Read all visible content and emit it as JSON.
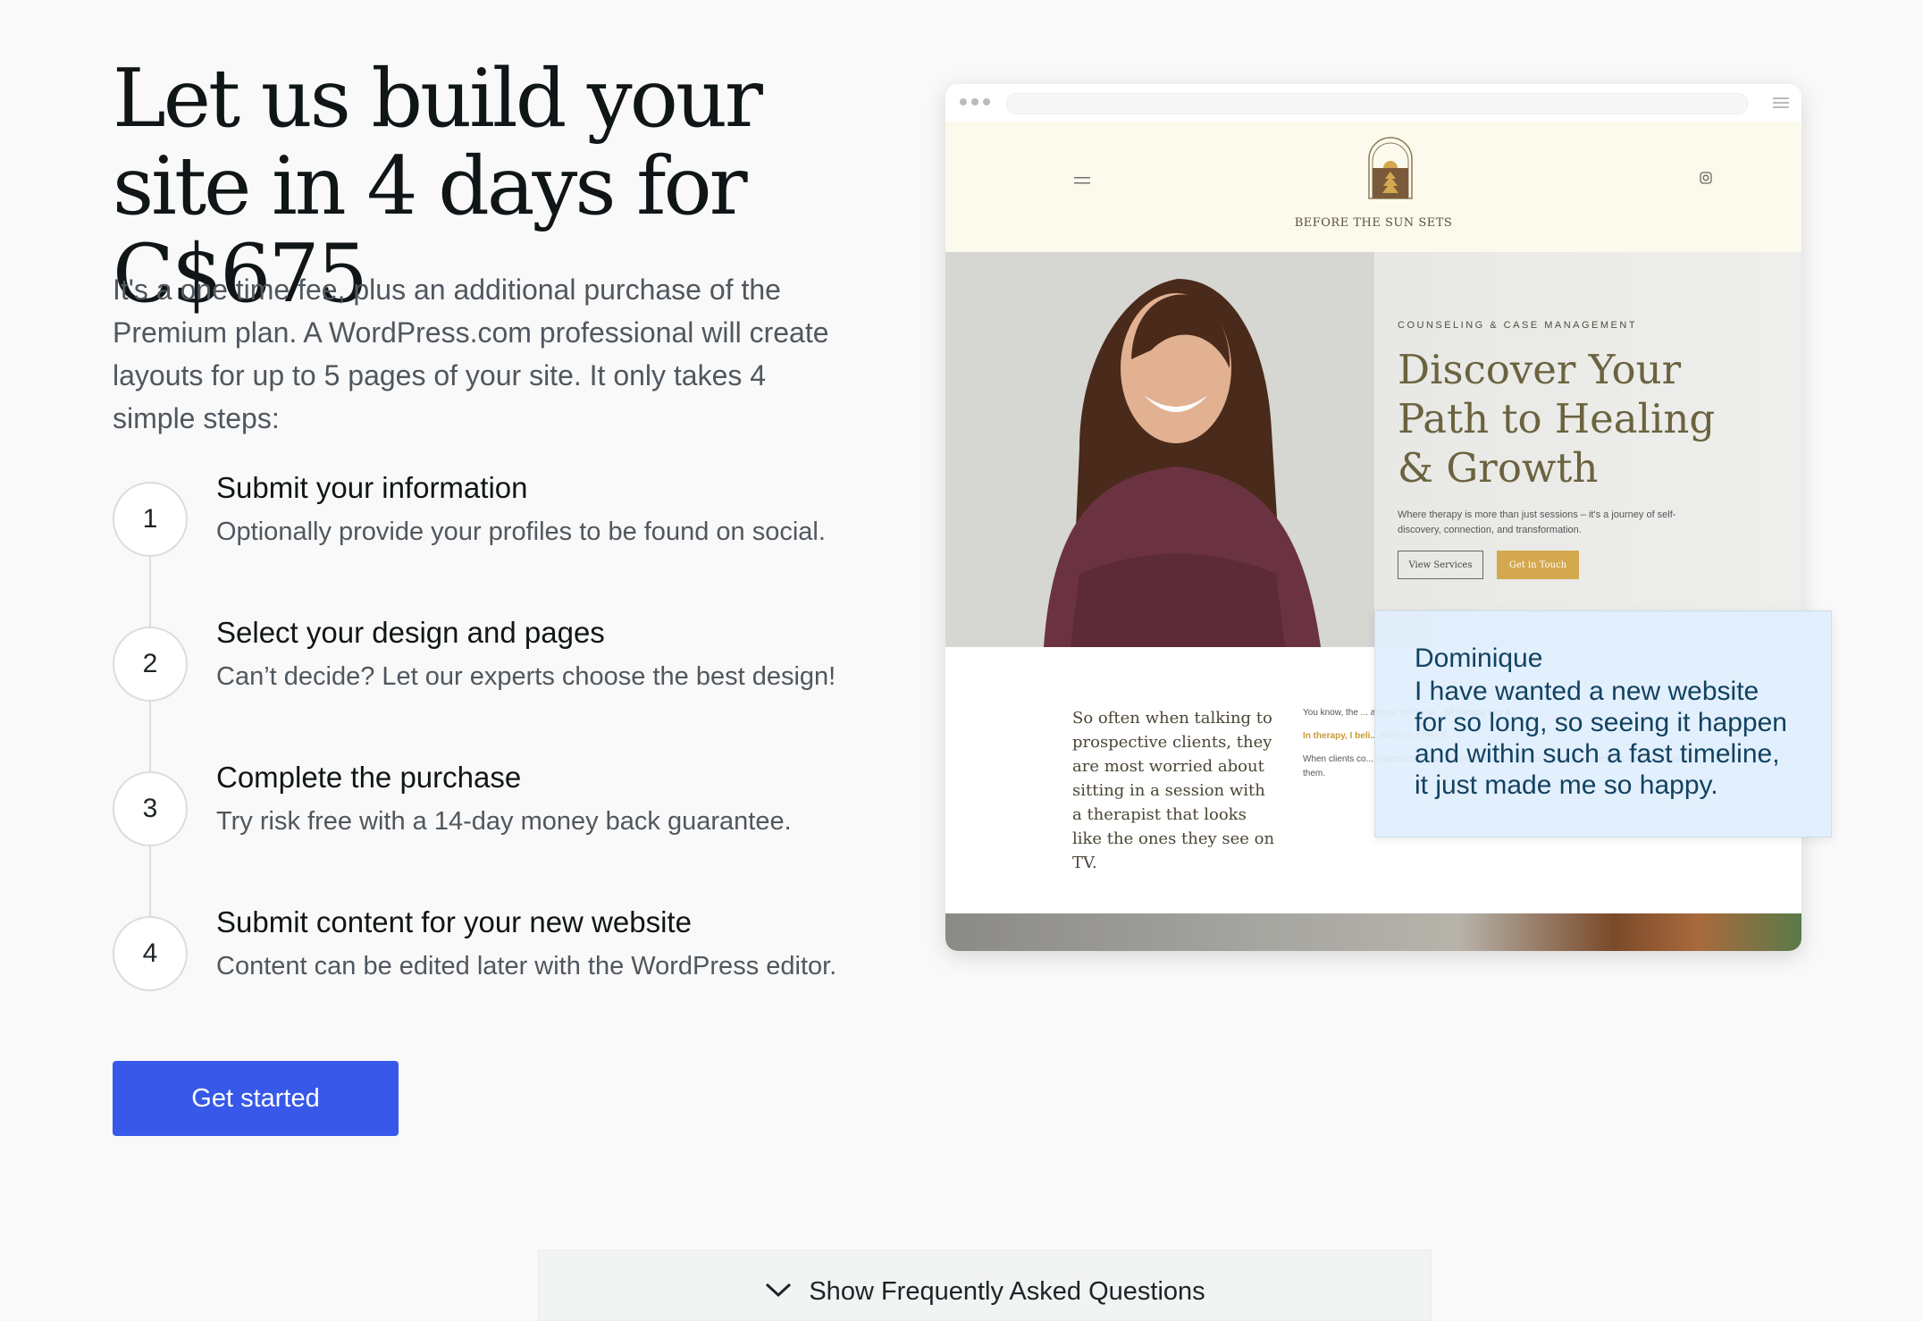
{
  "headline": "Let us build your site in 4 days for C$675",
  "intro": "It's a one time fee, plus an additional purchase of the Premium plan. A WordPress.com professional will create layouts for up to 5 pages of your site. It only takes 4 simple steps:",
  "steps": [
    {
      "number": "1",
      "title": "Submit your information",
      "desc": "Optionally provide your profiles to be found on social."
    },
    {
      "number": "2",
      "title": "Select your design and pages",
      "desc": "Can’t decide? Let our experts choose the best design!"
    },
    {
      "number": "3",
      "title": "Complete the purchase",
      "desc": "Try risk free with a 14-day money back guarantee."
    },
    {
      "number": "4",
      "title": "Submit content for your new website",
      "desc": "Content can be edited later with the WordPress editor."
    }
  ],
  "cta_label": "Get started",
  "faq_label": "Show Frequently Asked Questions",
  "preview": {
    "site_name": "BEFORE THE SUN SETS",
    "eyebrow": "COUNSELING & CASE MANAGEMENT",
    "hero_title": "Discover Your Path to Healing & Growth",
    "hero_sub": "Where therapy is more than just sessions – it's a journey of self-discovery, connection, and transformation.",
    "btn_services": "View Services",
    "btn_contact": "Get in Touch",
    "body_left": "So often when talking to prospective clients, they are most worried about sitting in a session with a therapist that looks like the ones they see on TV.",
    "body_right_1": "You know, the ... almost strictly ta... all therapy has a...",
    "body_right_2": "In therapy, I beli... there is a time f...",
    "body_right_3": "When clients co... importantly, that... themselves as they work through challenges most important to them."
  },
  "testimonial": {
    "name": "Dominique",
    "quote": "I have wanted a new website for so long, so seeing it happen and within such a fast timeline, it just made me so happy."
  },
  "colors": {
    "primary_button": "#3858e9",
    "testimonial_text": "#124261",
    "preview_header_bg": "#fcfaec",
    "preview_accent_gold": "#d4a84e"
  }
}
